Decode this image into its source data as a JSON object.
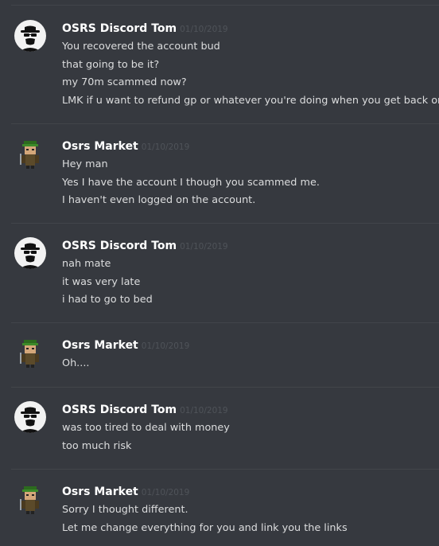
{
  "messages": [
    {
      "author": "OSRS Discord Tom",
      "avatar": "walter-white-avatar",
      "timestamp": "01/10/2019",
      "lines": [
        "You recovered the account bud",
        "that going to be it?",
        "my 70m scammed now?",
        "LMK if u want to refund gp or whatever you're doing when you get back on."
      ]
    },
    {
      "author": "Osrs Market",
      "avatar": "pixel-character-avatar",
      "timestamp": "01/10/2019",
      "lines": [
        "Hey man",
        "Yes I have the account I though you scammed me.",
        "I haven't even logged on the account."
      ]
    },
    {
      "author": "OSRS Discord Tom",
      "avatar": "walter-white-avatar",
      "timestamp": "01/10/2019",
      "lines": [
        "nah mate",
        "it was very late",
        "i had to go to bed"
      ]
    },
    {
      "author": "Osrs Market",
      "avatar": "pixel-character-avatar",
      "timestamp": "01/10/2019",
      "lines": [
        "Oh...."
      ]
    },
    {
      "author": "OSRS Discord Tom",
      "avatar": "walter-white-avatar",
      "timestamp": "01/10/2019",
      "lines": [
        "was too tired to deal with money",
        "too much risk"
      ]
    },
    {
      "author": "Osrs Market",
      "avatar": "pixel-character-avatar",
      "timestamp": "01/10/2019",
      "lines": [
        "Sorry I thought different.",
        "Let me change everything for you and link you the links"
      ]
    }
  ],
  "colors": {
    "background": "#36393f",
    "divider": "#42454a",
    "author": "#ffffff",
    "timestamp": "#4f5359",
    "text": "#dcddde"
  }
}
